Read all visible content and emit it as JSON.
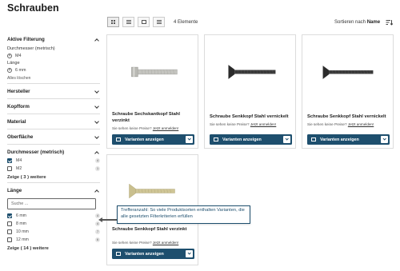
{
  "page": {
    "title": "Schrauben"
  },
  "sidebar": {
    "active_filter": {
      "title": "Aktive Filterung",
      "groups": [
        {
          "label": "Durchmesser (metrisch)",
          "chips": [
            "M4"
          ]
        },
        {
          "label": "Länge",
          "chips": [
            "6 mm"
          ]
        }
      ],
      "clear_all": "Alles löschen"
    },
    "sections": [
      "Hersteller",
      "Kopfform",
      "Material",
      "Oberfläche"
    ],
    "diameter": {
      "title": "Durchmesser (metrisch)",
      "options": [
        {
          "label": "M4",
          "checked": true,
          "count": "4"
        },
        {
          "label": "M2",
          "checked": false,
          "count": "1"
        }
      ],
      "show_more": "Zeige ( 3 ) weitere"
    },
    "length": {
      "title": "Länge",
      "search_placeholder": "Suche ...",
      "options": [
        {
          "label": "6 mm",
          "checked": true,
          "count": "4"
        },
        {
          "label": "8 mm",
          "checked": false,
          "count": "4"
        },
        {
          "label": "10 mm",
          "checked": false,
          "count": "7"
        },
        {
          "label": "12 mm",
          "checked": false,
          "count": "6"
        }
      ],
      "show_more": "Zeige ( 14 ) weitere"
    }
  },
  "toolbar": {
    "views": [
      "grid-view-icon",
      "list-view-icon",
      "wide-view-icon",
      "table-view-icon"
    ],
    "count": "4 Elemente",
    "sort_prefix": "Sortieren nach",
    "sort_value": "Name"
  },
  "products": [
    {
      "title": "Schraube Sechskantkopf Stahl verzinkt",
      "image": "hex-head-screw",
      "price_note": "Sie sehen keine Preise?",
      "login_link": "Jetzt anmelden!",
      "button": "Varianten anzeigen"
    },
    {
      "title": "Schraube Senkkopf Stahl vernickelt",
      "image": "black-countersunk-screw",
      "price_note": "Sie sehen keine Preise?",
      "login_link": "Jetzt anmelden!",
      "button": "Varianten anzeigen"
    },
    {
      "title": "Schraube Senkkopf Stahl vernickelt",
      "image": "black-countersunk-screw",
      "price_note": "Sie sehen keine Preise?",
      "login_link": "Jetzt anmelden!",
      "button": "Varianten anzeigen"
    },
    {
      "title": "Schraube Senkkopf Stahl verzinkt",
      "image": "zinc-countersunk-screw",
      "price_note": "Sie sehen keine Preise?",
      "login_link": "Jetzt anmelden!",
      "button": "Varianten anzeigen"
    }
  ],
  "tooltip": {
    "text": "Trefferanzahl: So viele Produktsorten enthalten Varianten, die alle gesetzten Filterkriterien erfüllen"
  },
  "colors": {
    "accent": "#1e4f6e",
    "tooltip_border": "#1e4f6e"
  }
}
